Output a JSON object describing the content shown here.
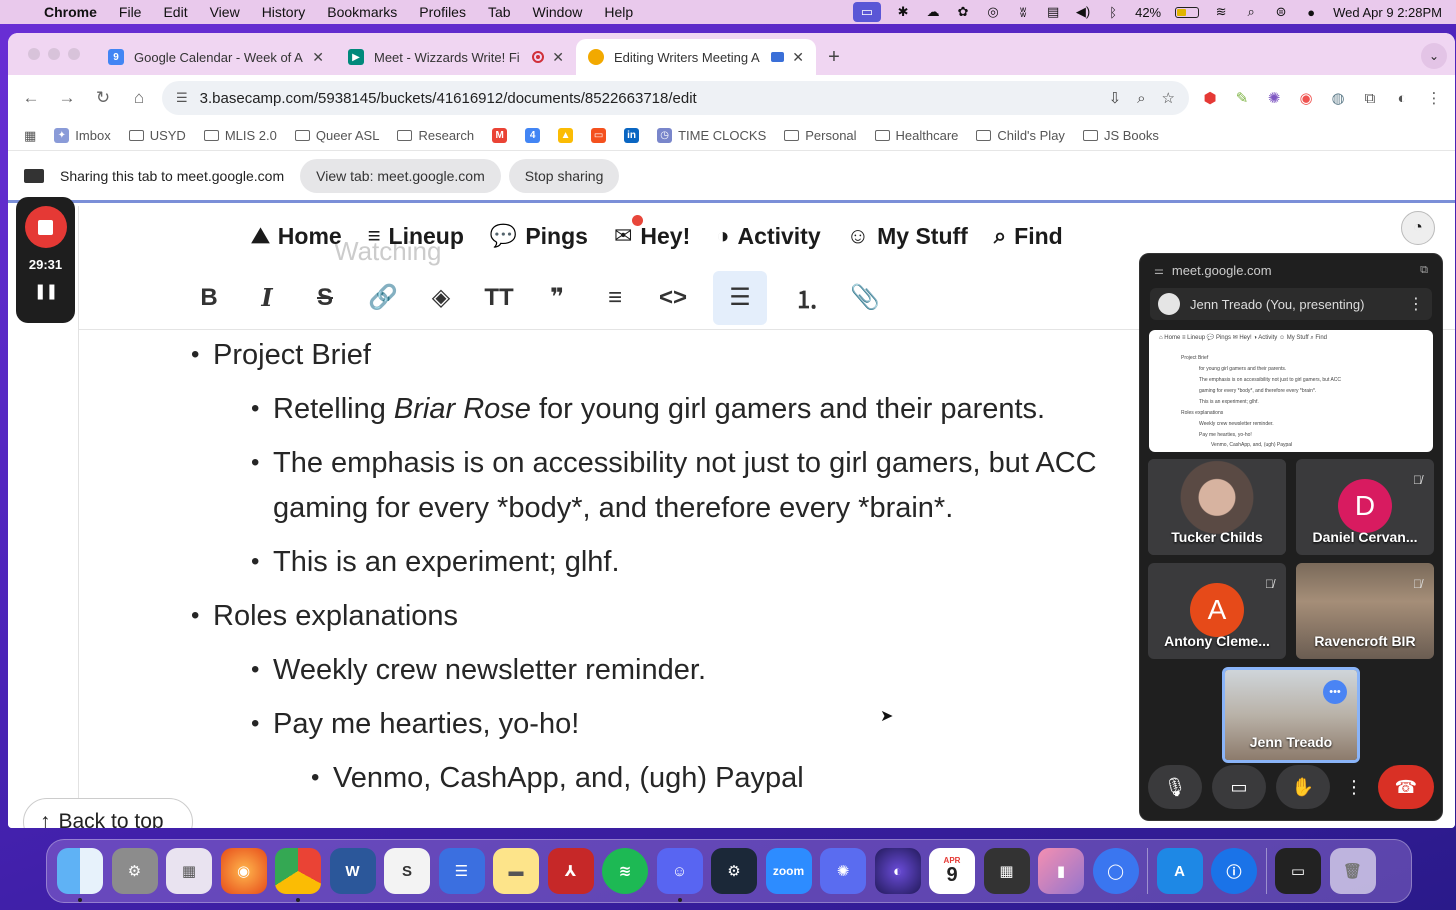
{
  "menubar": {
    "app": "Chrome",
    "items": [
      "File",
      "Edit",
      "View",
      "History",
      "Bookmarks",
      "Profiles",
      "Tab",
      "Window",
      "Help"
    ],
    "battery_text": "42%",
    "battery_level": 0.42,
    "datetime": "Wed Apr 9  2:28PM"
  },
  "tabs": [
    {
      "title": "Google Calendar - Week of A",
      "favicon": "calendar-icon",
      "color": "#4285f4"
    },
    {
      "title": "Meet - Wizzards Write! Fi",
      "favicon": "meet-icon",
      "color": "#00897b"
    },
    {
      "title": "Editing Writers Meeting A",
      "favicon": "basecamp-icon",
      "color": "#f2a900"
    }
  ],
  "address": {
    "url": "3.basecamp.com/5938145/buckets/41616912/documents/8522663718/edit"
  },
  "bookmarks": [
    "Imbox",
    "USYD",
    "MLIS 2.0",
    "Queer ASL",
    "Research",
    "TIME CLOCKS",
    "Personal",
    "Healthcare",
    "Child's Play",
    "JS Books"
  ],
  "sharebar": {
    "text": "Sharing this tab to meet.google.com",
    "view_tab": "View tab: meet.google.com",
    "stop": "Stop sharing"
  },
  "recording": {
    "time": "29:31"
  },
  "basecamp_nav": {
    "items": [
      "Home",
      "Lineup",
      "Pings",
      "Hey!",
      "Activity",
      "My Stuff",
      "Find"
    ],
    "ghost_text": "Watching"
  },
  "document": {
    "lines": [
      {
        "level": 1,
        "pre": "Project Brief"
      },
      {
        "level": 2,
        "pre": "Retelling ",
        "em": "Briar Rose",
        "post": " for young girl gamers and their parents."
      },
      {
        "level": 2,
        "pre": "The emphasis is on accessibility not just to girl gamers, but ACC"
      },
      {
        "level": 2,
        "cont": true,
        "pre": "gaming for every *body*, and therefore every *brain*."
      },
      {
        "level": 2,
        "pre": "This is an experiment; glhf."
      },
      {
        "level": 1,
        "pre": "Roles explanations"
      },
      {
        "level": 2,
        "pre": "Weekly crew newsletter reminder."
      },
      {
        "level": 2,
        "pre": "Pay me hearties, yo-ho!"
      },
      {
        "level": 3,
        "pre": "Venmo, CashApp, and, (ugh) Paypal"
      }
    ],
    "back_to_top": "Back to top"
  },
  "meet": {
    "origin": "meet.google.com",
    "presenter": "Jenn Treado (You, presenting)",
    "participants": [
      {
        "name": "Tucker Childs",
        "type": "video",
        "muted": false
      },
      {
        "name": "Daniel Cervan...",
        "type": "letter",
        "letter": "D",
        "color": "#d81b60",
        "muted": true
      },
      {
        "name": "Antony Cleme...",
        "type": "letter",
        "letter": "A",
        "color": "#e64a19",
        "muted": true
      },
      {
        "name": "Ravencroft BIR",
        "type": "video",
        "muted": true
      },
      {
        "name": "Jenn Treado",
        "type": "video",
        "muted": false,
        "self": true
      }
    ]
  },
  "dock": {
    "apps": [
      "Finder",
      "System Settings",
      "Launchpad",
      "Firefox",
      "Chrome",
      "Word",
      "Scrivener",
      "Bear",
      "Notes",
      "Acrobat",
      "Spotify",
      "Discord",
      "Steam",
      "zoom",
      "Bitwarden",
      "Arc",
      "Calendar",
      "Calculator",
      "Notebook",
      "Signal",
      "App Store",
      "1Password",
      "Screen",
      "Trash"
    ],
    "calendar_month": "APR",
    "calendar_day": "9"
  }
}
